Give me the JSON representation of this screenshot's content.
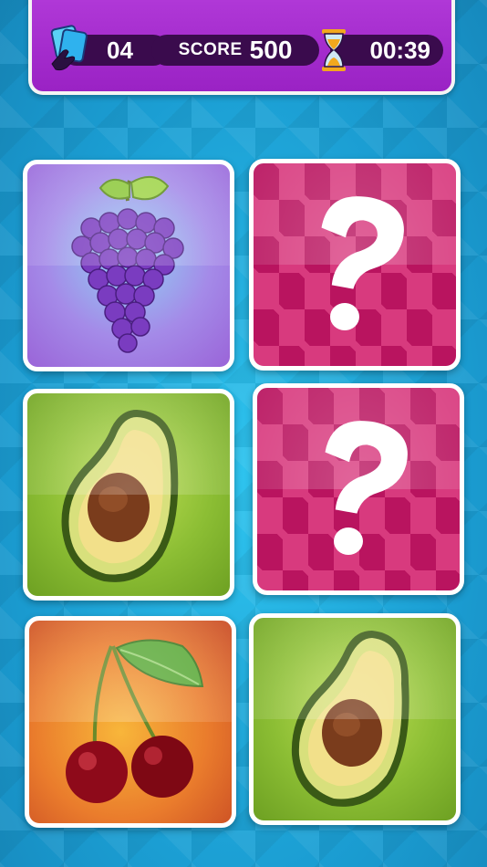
{
  "hud": {
    "moves": "04",
    "score_label": "SCORE",
    "score": "500",
    "timer": "00:39",
    "moves_icon": "cards-hand-icon",
    "timer_icon": "hourglass-icon"
  },
  "cards": [
    {
      "state": "revealed",
      "fruit": "grape"
    },
    {
      "state": "hidden",
      "symbol": "?"
    },
    {
      "state": "revealed",
      "fruit": "avocado"
    },
    {
      "state": "hidden",
      "symbol": "?"
    },
    {
      "state": "revealed",
      "fruit": "cherry"
    },
    {
      "state": "revealed",
      "fruit": "avocado"
    }
  ],
  "colors": {
    "hud_purple": "#a42bcc",
    "pill_dark": "#3a0b4d",
    "card_back": "#b9145f",
    "background": "#1fa6d8"
  }
}
